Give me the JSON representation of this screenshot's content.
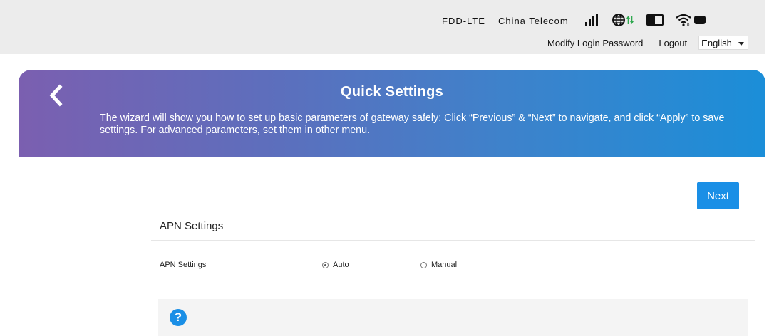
{
  "status": {
    "network_type": "FDD-LTE",
    "carrier": "China Telecom",
    "icons": [
      "signal-strength-icon",
      "internet-globe-icon",
      "data-transfer-arrows-icon",
      "battery-icon",
      "wifi-icon",
      "message-icon"
    ]
  },
  "header_links": {
    "modify_password": "Modify Login Password",
    "logout": "Logout",
    "language": "English"
  },
  "banner": {
    "title": "Quick Settings",
    "description": "The wizard will show you how to set up basic parameters of gateway safely: Click “Previous” & “Next” to navigate, and click “Apply” to save settings. For advanced parameters, set them in other menu.",
    "back_icon": "chevron-left-icon"
  },
  "wizard": {
    "next_label": "Next",
    "section_title": "APN Settings",
    "apn_label": "APN Settings",
    "options": [
      "Auto",
      "Manual"
    ],
    "selected": "Auto"
  },
  "help": {
    "icon_text": "?"
  },
  "colors": {
    "accent": "#1a8fe6",
    "banner_start": "#7b5fb0",
    "banner_end": "#1b8ed8",
    "topbar": "#ececec",
    "signal_green": "#2fa84f"
  }
}
